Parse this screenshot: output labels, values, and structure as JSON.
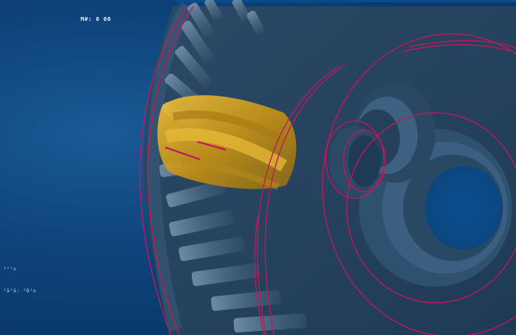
{
  "viewport": {
    "name": "3D model viewport",
    "background": "#0d4178",
    "model_color": "#2e4d68",
    "highlight_color": "#d9a521",
    "edge_color": "#c0185a"
  },
  "hud": {
    "top_label": "M#: 0 00",
    "bottom_label_1": "³°²±",
    "bottom_label_2": "²å²à: ²Ð²±"
  }
}
